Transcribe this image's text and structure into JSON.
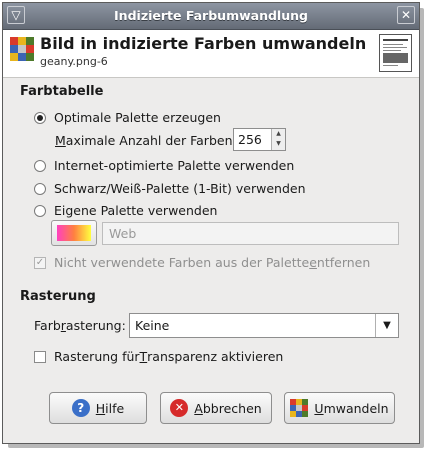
{
  "window": {
    "title": "Indizierte Farbumwandlung",
    "menu_symbol": "▽",
    "close_symbol": "✕"
  },
  "header": {
    "title": "Bild in indizierte Farben umwandeln",
    "subtitle": "geany.png-6"
  },
  "colormap": {
    "section_label": "Farbtabelle",
    "optimal_label": "Optimale Palette erzeugen",
    "max_colors_prefix": "M",
    "max_colors_rest": "aximale Anzahl der Farben:",
    "max_colors_value": "256",
    "web_label": "Internet-optimierte Palette verwenden",
    "mono_label": "Schwarz/Weiß-Palette (1-Bit) verwenden",
    "custom_label": "Eigene Palette verwenden",
    "palette_name": "Web",
    "remove_unused_pre": "Nicht verwendete Farben aus der Palette ",
    "remove_unused_u": "e",
    "remove_unused_post": "ntfernen",
    "selected": "optimal",
    "remove_unused_checked": true
  },
  "dithering": {
    "section_label": "Rasterung",
    "label_pre": "Farb",
    "label_u": "r",
    "label_post": "asterung:",
    "selected": "Keine",
    "transparency_pre": "Rasterung für ",
    "transparency_u": "T",
    "transparency_post": "ransparenz aktivieren",
    "transparency_checked": false
  },
  "buttons": {
    "help_u": "H",
    "help_rest": "ilfe",
    "cancel_u": "A",
    "cancel_rest": "bbrechen",
    "convert_u": "U",
    "convert_rest": "mwandeln"
  },
  "icons": {
    "app_grid_colors": [
      "#d93a2b",
      "#e8b51e",
      "#4d7a2a",
      "#3c64b4",
      "#c8c8c8",
      "#d93a2b",
      "#e8b51e",
      "#3c64b4",
      "#4d7a2a"
    ]
  }
}
